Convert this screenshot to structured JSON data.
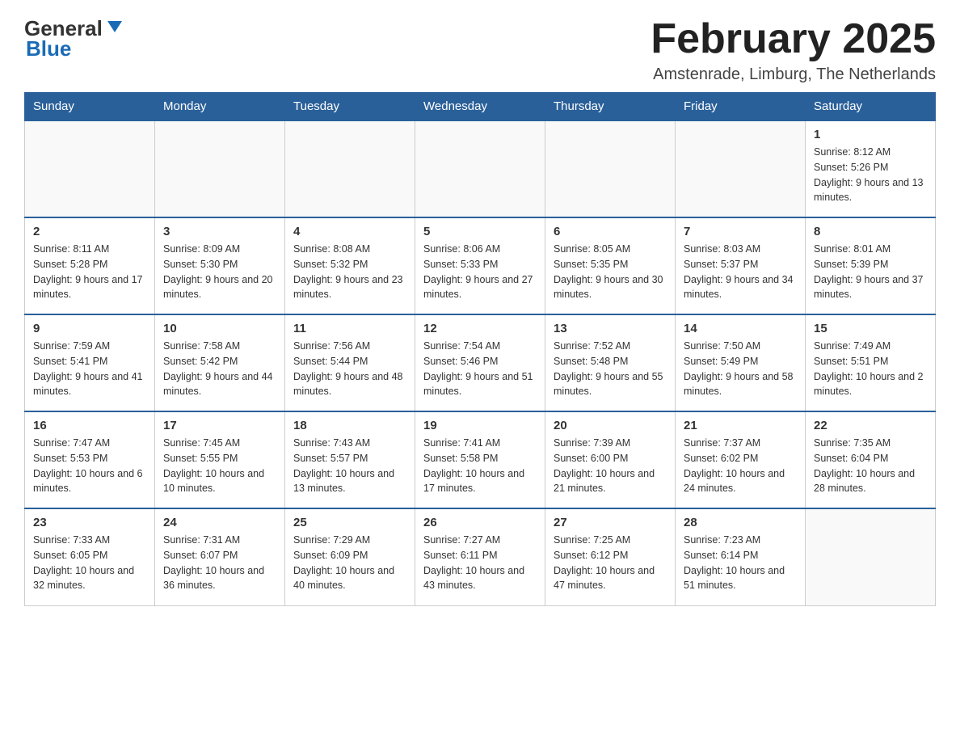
{
  "header": {
    "logo_general": "General",
    "logo_blue": "Blue",
    "month_title": "February 2025",
    "location": "Amstenrade, Limburg, The Netherlands"
  },
  "days_of_week": [
    "Sunday",
    "Monday",
    "Tuesday",
    "Wednesday",
    "Thursday",
    "Friday",
    "Saturday"
  ],
  "weeks": [
    [
      {
        "day": "",
        "info": ""
      },
      {
        "day": "",
        "info": ""
      },
      {
        "day": "",
        "info": ""
      },
      {
        "day": "",
        "info": ""
      },
      {
        "day": "",
        "info": ""
      },
      {
        "day": "",
        "info": ""
      },
      {
        "day": "1",
        "info": "Sunrise: 8:12 AM\nSunset: 5:26 PM\nDaylight: 9 hours and 13 minutes."
      }
    ],
    [
      {
        "day": "2",
        "info": "Sunrise: 8:11 AM\nSunset: 5:28 PM\nDaylight: 9 hours and 17 minutes."
      },
      {
        "day": "3",
        "info": "Sunrise: 8:09 AM\nSunset: 5:30 PM\nDaylight: 9 hours and 20 minutes."
      },
      {
        "day": "4",
        "info": "Sunrise: 8:08 AM\nSunset: 5:32 PM\nDaylight: 9 hours and 23 minutes."
      },
      {
        "day": "5",
        "info": "Sunrise: 8:06 AM\nSunset: 5:33 PM\nDaylight: 9 hours and 27 minutes."
      },
      {
        "day": "6",
        "info": "Sunrise: 8:05 AM\nSunset: 5:35 PM\nDaylight: 9 hours and 30 minutes."
      },
      {
        "day": "7",
        "info": "Sunrise: 8:03 AM\nSunset: 5:37 PM\nDaylight: 9 hours and 34 minutes."
      },
      {
        "day": "8",
        "info": "Sunrise: 8:01 AM\nSunset: 5:39 PM\nDaylight: 9 hours and 37 minutes."
      }
    ],
    [
      {
        "day": "9",
        "info": "Sunrise: 7:59 AM\nSunset: 5:41 PM\nDaylight: 9 hours and 41 minutes."
      },
      {
        "day": "10",
        "info": "Sunrise: 7:58 AM\nSunset: 5:42 PM\nDaylight: 9 hours and 44 minutes."
      },
      {
        "day": "11",
        "info": "Sunrise: 7:56 AM\nSunset: 5:44 PM\nDaylight: 9 hours and 48 minutes."
      },
      {
        "day": "12",
        "info": "Sunrise: 7:54 AM\nSunset: 5:46 PM\nDaylight: 9 hours and 51 minutes."
      },
      {
        "day": "13",
        "info": "Sunrise: 7:52 AM\nSunset: 5:48 PM\nDaylight: 9 hours and 55 minutes."
      },
      {
        "day": "14",
        "info": "Sunrise: 7:50 AM\nSunset: 5:49 PM\nDaylight: 9 hours and 58 minutes."
      },
      {
        "day": "15",
        "info": "Sunrise: 7:49 AM\nSunset: 5:51 PM\nDaylight: 10 hours and 2 minutes."
      }
    ],
    [
      {
        "day": "16",
        "info": "Sunrise: 7:47 AM\nSunset: 5:53 PM\nDaylight: 10 hours and 6 minutes."
      },
      {
        "day": "17",
        "info": "Sunrise: 7:45 AM\nSunset: 5:55 PM\nDaylight: 10 hours and 10 minutes."
      },
      {
        "day": "18",
        "info": "Sunrise: 7:43 AM\nSunset: 5:57 PM\nDaylight: 10 hours and 13 minutes."
      },
      {
        "day": "19",
        "info": "Sunrise: 7:41 AM\nSunset: 5:58 PM\nDaylight: 10 hours and 17 minutes."
      },
      {
        "day": "20",
        "info": "Sunrise: 7:39 AM\nSunset: 6:00 PM\nDaylight: 10 hours and 21 minutes."
      },
      {
        "day": "21",
        "info": "Sunrise: 7:37 AM\nSunset: 6:02 PM\nDaylight: 10 hours and 24 minutes."
      },
      {
        "day": "22",
        "info": "Sunrise: 7:35 AM\nSunset: 6:04 PM\nDaylight: 10 hours and 28 minutes."
      }
    ],
    [
      {
        "day": "23",
        "info": "Sunrise: 7:33 AM\nSunset: 6:05 PM\nDaylight: 10 hours and 32 minutes."
      },
      {
        "day": "24",
        "info": "Sunrise: 7:31 AM\nSunset: 6:07 PM\nDaylight: 10 hours and 36 minutes."
      },
      {
        "day": "25",
        "info": "Sunrise: 7:29 AM\nSunset: 6:09 PM\nDaylight: 10 hours and 40 minutes."
      },
      {
        "day": "26",
        "info": "Sunrise: 7:27 AM\nSunset: 6:11 PM\nDaylight: 10 hours and 43 minutes."
      },
      {
        "day": "27",
        "info": "Sunrise: 7:25 AM\nSunset: 6:12 PM\nDaylight: 10 hours and 47 minutes."
      },
      {
        "day": "28",
        "info": "Sunrise: 7:23 AM\nSunset: 6:14 PM\nDaylight: 10 hours and 51 minutes."
      },
      {
        "day": "",
        "info": ""
      }
    ]
  ]
}
